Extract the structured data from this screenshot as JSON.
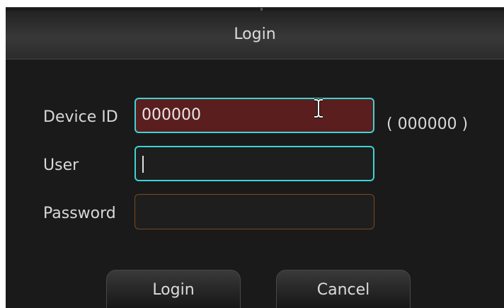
{
  "dialog": {
    "title": "Login"
  },
  "form": {
    "device_id": {
      "label": "Device ID",
      "value": "000000",
      "hint": "( 000000 )"
    },
    "user": {
      "label": "User",
      "value": ""
    },
    "password": {
      "label": "Password",
      "value": ""
    }
  },
  "buttons": {
    "login_label": "Login",
    "cancel_label": "Cancel"
  },
  "colors": {
    "focus_border": "#3ed3d6",
    "device_field_bg": "#5a1e1e",
    "password_border": "#7a4a1c",
    "background": "#1a1a1a"
  },
  "icons": {
    "cursor": "i-beam-cursor-icon"
  }
}
